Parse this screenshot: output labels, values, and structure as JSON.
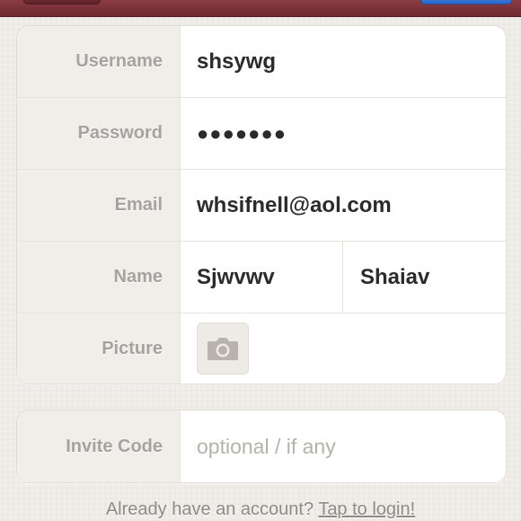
{
  "form": {
    "username": {
      "label": "Username",
      "value": "shsywg"
    },
    "password": {
      "label": "Password",
      "value": "●●●●●●●"
    },
    "email": {
      "label": "Email",
      "value": "whsifnell@aol.com"
    },
    "name": {
      "label": "Name",
      "first": "Sjwvwv",
      "last": "Shaiav"
    },
    "picture": {
      "label": "Picture",
      "icon": "camera-icon"
    }
  },
  "invite": {
    "label": "Invite Code",
    "placeholder": "optional / if any"
  },
  "footer": {
    "text": "Already have an account?",
    "link": "Tap to login!"
  },
  "colors": {
    "header": "#7a3239",
    "primary": "#2a67c7",
    "background": "#efebe6"
  }
}
